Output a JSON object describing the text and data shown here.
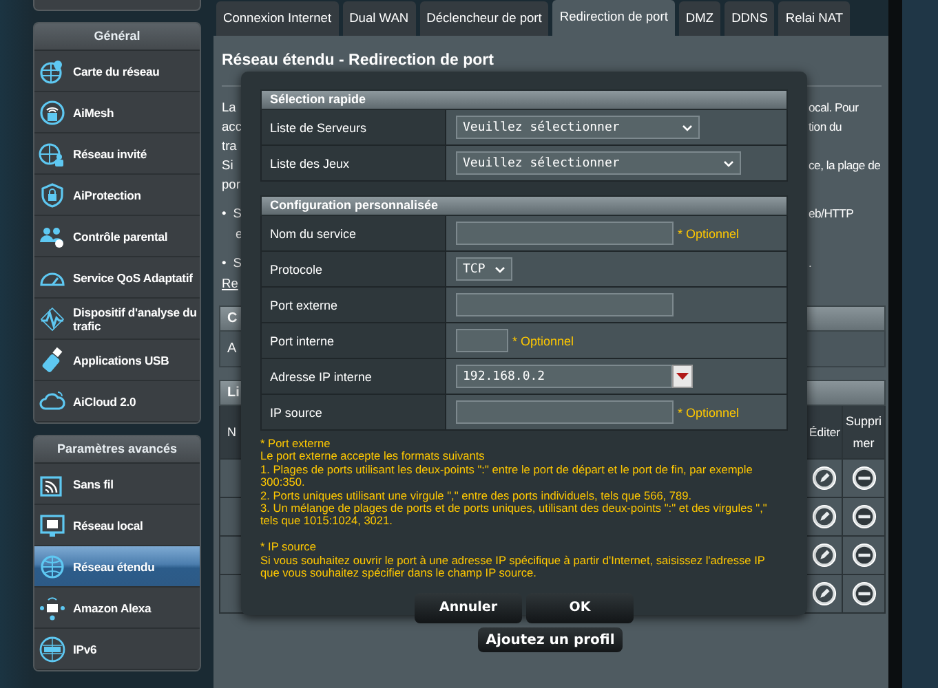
{
  "sidebar": {
    "sections": [
      {
        "title": "Général",
        "items": [
          {
            "label": "Carte du réseau",
            "selected": false
          },
          {
            "label": "AiMesh",
            "selected": false
          },
          {
            "label": "Réseau invité",
            "selected": false
          },
          {
            "label": "AiProtection",
            "selected": false
          },
          {
            "label": "Contrôle parental",
            "selected": false
          },
          {
            "label": "Service QoS Adaptatif",
            "selected": false
          },
          {
            "label": "Dispositif d'analyse du trafic",
            "selected": false
          },
          {
            "label": "Applications USB",
            "selected": false
          },
          {
            "label": "AiCloud 2.0",
            "selected": false
          }
        ]
      },
      {
        "title": "Paramètres avancés",
        "items": [
          {
            "label": "Sans fil",
            "selected": false
          },
          {
            "label": "Réseau local",
            "selected": false
          },
          {
            "label": "Réseau étendu",
            "selected": true
          },
          {
            "label": "Amazon Alexa",
            "selected": false
          },
          {
            "label": "IPv6",
            "selected": false
          }
        ]
      }
    ]
  },
  "tabs": [
    {
      "label": "Connexion Internet",
      "selected": false
    },
    {
      "label": "Dual WAN",
      "selected": false
    },
    {
      "label": "Déclencheur de port",
      "selected": false
    },
    {
      "label": "Redirection de port",
      "selected": true
    },
    {
      "label": "DMZ",
      "selected": false
    },
    {
      "label": "DDNS",
      "selected": false
    },
    {
      "label": "Relai NAT",
      "selected": false
    }
  ],
  "page": {
    "title": "Réseau étendu - Redirection de port",
    "lines": [
      {
        "kind": "text",
        "left": "La",
        "right": "ocal. Pour"
      },
      {
        "kind": "text",
        "left": "acc",
        "right": "tion du"
      },
      {
        "kind": "text",
        "left": "tra"
      },
      {
        "kind": "text",
        "left": "Si",
        "right": "ce, la plage de"
      },
      {
        "kind": "text",
        "left": "por"
      },
      {
        "kind": "bullet",
        "marker": "•",
        "left": "S",
        "right": "eb/HTTP"
      },
      {
        "kind": "continuation",
        "left": "e"
      },
      {
        "kind": "bullet",
        "marker": "•",
        "left": "S",
        "right": "."
      },
      {
        "kind": "link",
        "left": "Re"
      }
    ],
    "tables": [
      {
        "header": "C",
        "rows": [
          "A"
        ]
      },
      {
        "header": "Li",
        "column_1": "N",
        "columns_right": [
          "Éditer",
          "Supprimer"
        ],
        "rows": [
          {
            "editable": true,
            "deletable": true
          },
          {
            "editable": true,
            "deletable": true
          },
          {
            "editable": true,
            "deletable": true
          },
          {
            "editable": true,
            "deletable": true
          }
        ]
      }
    ],
    "add_button": "Ajoutez un profil"
  },
  "dialog": {
    "sections": [
      {
        "title": "Sélection rapide",
        "rows": [
          {
            "label": "Liste de Serveurs",
            "kind": "select",
            "value": "Veuillez sélectionner"
          },
          {
            "label": "Liste des Jeux",
            "kind": "select",
            "value": "Veuillez sélectionner"
          }
        ]
      },
      {
        "title": "Configuration personnalisée",
        "rows": [
          {
            "label": "Nom du service",
            "kind": "input",
            "note": "* Optionnel"
          },
          {
            "label": "Protocole",
            "kind": "select-small",
            "value": "TCP"
          },
          {
            "label": "Port externe",
            "kind": "input"
          },
          {
            "label": "Port interne",
            "kind": "input-small",
            "note": "* Optionnel"
          },
          {
            "label": "Adresse IP interne",
            "kind": "ip-combo",
            "value": "192.168.0.2"
          },
          {
            "label": "IP source",
            "kind": "input",
            "note": "* Optionnel"
          }
        ]
      }
    ],
    "notes": [
      {
        "lines": [
          "* Port externe",
          "Le port externe accepte les formats suivants",
          "1. Plages de ports utilisant les deux-points \":\" entre le port de départ et le port de fin, par exemple 300:350.",
          "2. Ports uniques utilisant une virgule \",\" entre des ports individuels, tels que 566, 789.",
          "3. Un mélange de plages de ports et de ports uniques, utilisant des deux-points \":\" et des virgules \",\" tels que 1015:1024, 3021."
        ]
      },
      {
        "lines": [
          "* IP source",
          "Si vous souhaitez ouvrir le port à une adresse IP spécifique à partir d'Internet, saisissez l'adresse IP que vous souhaitez spécifier dans le champ IP source."
        ]
      }
    ],
    "buttons": [
      "Annuler",
      "OK"
    ]
  }
}
